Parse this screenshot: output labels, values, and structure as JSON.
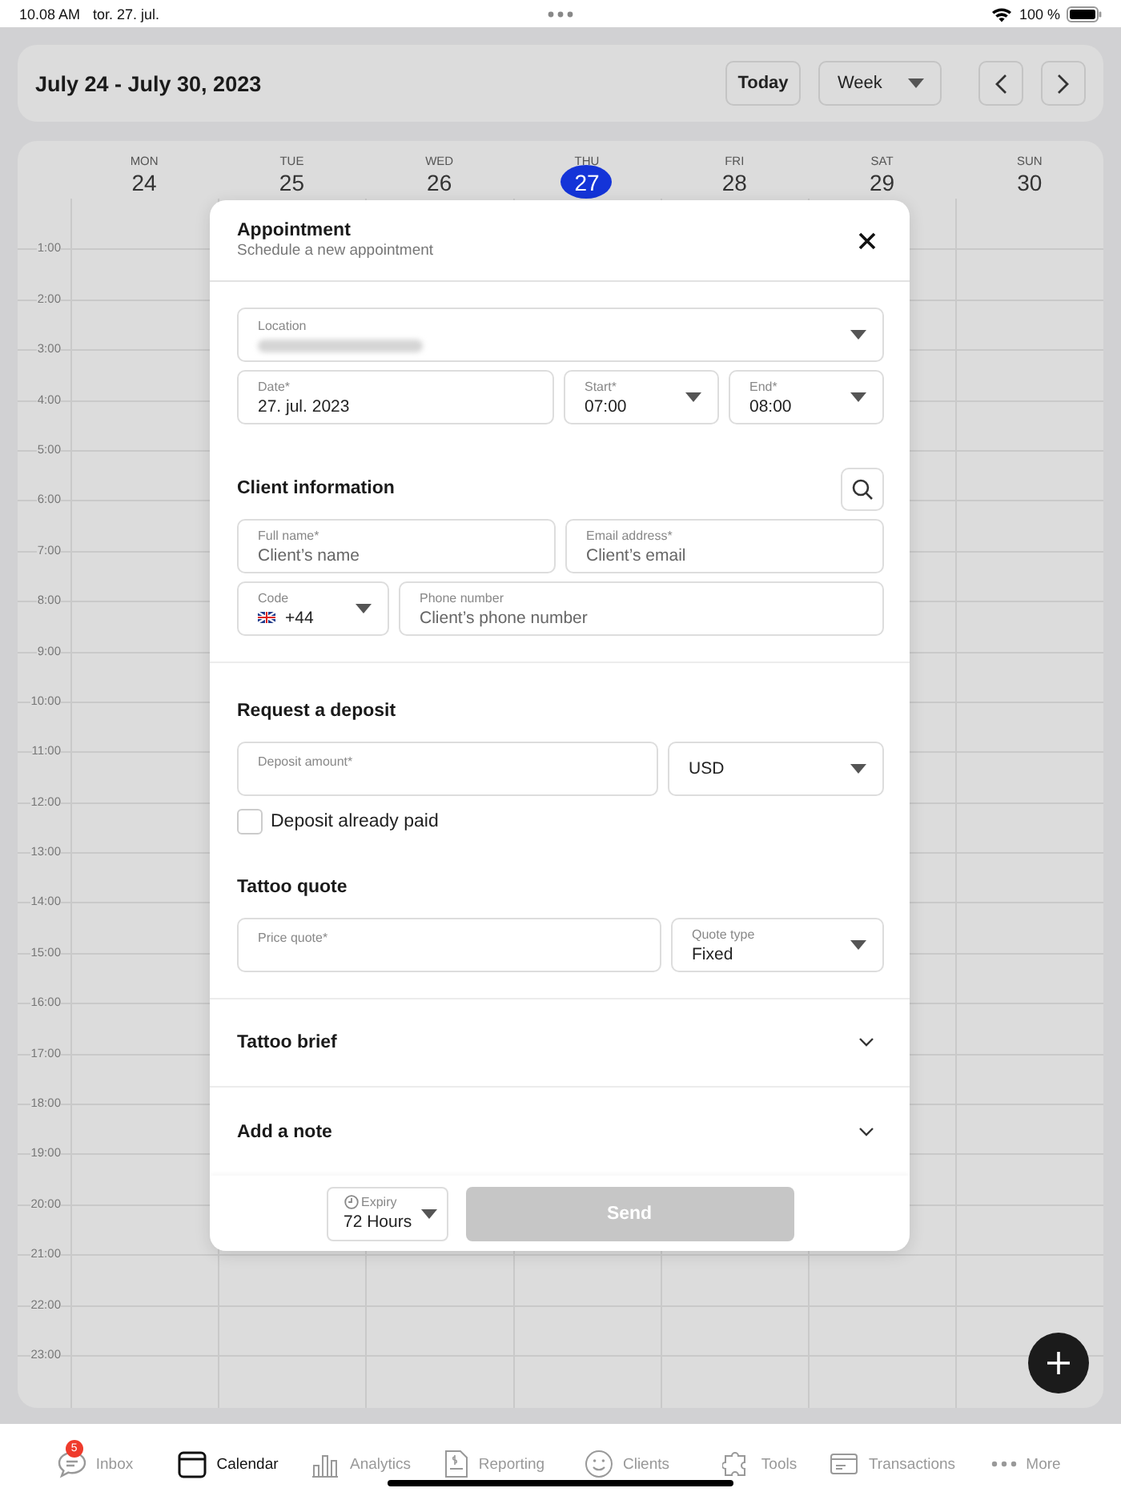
{
  "status_bar": {
    "time": "10.08 AM",
    "date": "tor. 27. jul.",
    "battery": "100 %"
  },
  "header": {
    "title": "July 24 - July 30, 2023",
    "today_button": "Today",
    "view_select": "Week"
  },
  "days": [
    {
      "name": "MON",
      "number": "24",
      "selected": false
    },
    {
      "name": "TUE",
      "number": "25",
      "selected": false
    },
    {
      "name": "WED",
      "number": "26",
      "selected": false
    },
    {
      "name": "THU",
      "number": "27",
      "selected": true
    },
    {
      "name": "FRI",
      "number": "28",
      "selected": false
    },
    {
      "name": "SAT",
      "number": "29",
      "selected": false
    },
    {
      "name": "SUN",
      "number": "30",
      "selected": false
    }
  ],
  "hours": [
    "1:00",
    "2:00",
    "3:00",
    "4:00",
    "5:00",
    "6:00",
    "7:00",
    "8:00",
    "9:00",
    "10:00",
    "11:00",
    "12:00",
    "13:00",
    "14:00",
    "15:00",
    "16:00",
    "17:00",
    "18:00",
    "19:00",
    "20:00",
    "21:00",
    "22:00",
    "23:00"
  ],
  "modal": {
    "title": "Appointment",
    "subtitle": "Schedule a new appointment",
    "location": {
      "label": "Location"
    },
    "date": {
      "label": "Date*",
      "value": "27. jul. 2023"
    },
    "start": {
      "label": "Start*",
      "value": "07:00"
    },
    "end": {
      "label": "End*",
      "value": "08:00"
    },
    "client_section": "Client information",
    "full_name": {
      "label": "Full name*",
      "placeholder": "Client’s name"
    },
    "email": {
      "label": "Email address*",
      "placeholder": "Client’s email"
    },
    "code": {
      "label": "Code",
      "value": "+44"
    },
    "phone": {
      "label": "Phone number",
      "placeholder": "Client’s phone number"
    },
    "deposit_section": "Request a deposit",
    "deposit_amount": {
      "label": "Deposit amount*"
    },
    "currency": {
      "value": "USD"
    },
    "deposit_paid": {
      "label": "Deposit already paid",
      "checked": false
    },
    "quote_section": "Tattoo quote",
    "price_quote": {
      "label": "Price quote*"
    },
    "quote_type": {
      "label": "Quote type",
      "value": "Fixed"
    },
    "collapsibles": [
      {
        "title": "Tattoo brief",
        "expanded": false
      },
      {
        "title": "Add a note",
        "expanded": false
      }
    ],
    "expiry": {
      "label": "Expiry",
      "value": "72 Hours"
    },
    "send_button": {
      "label": "Send",
      "disabled": true
    }
  },
  "tab_bar": [
    {
      "label": "Inbox",
      "selected": false,
      "badge": "5"
    },
    {
      "label": "Calendar",
      "selected": true
    },
    {
      "label": "Analytics",
      "selected": false
    },
    {
      "label": "Reporting",
      "selected": false
    },
    {
      "label": "Clients",
      "selected": false
    },
    {
      "label": "Tools",
      "selected": false
    },
    {
      "label": "Transactions",
      "selected": false
    },
    {
      "label": "More",
      "selected": false
    }
  ]
}
